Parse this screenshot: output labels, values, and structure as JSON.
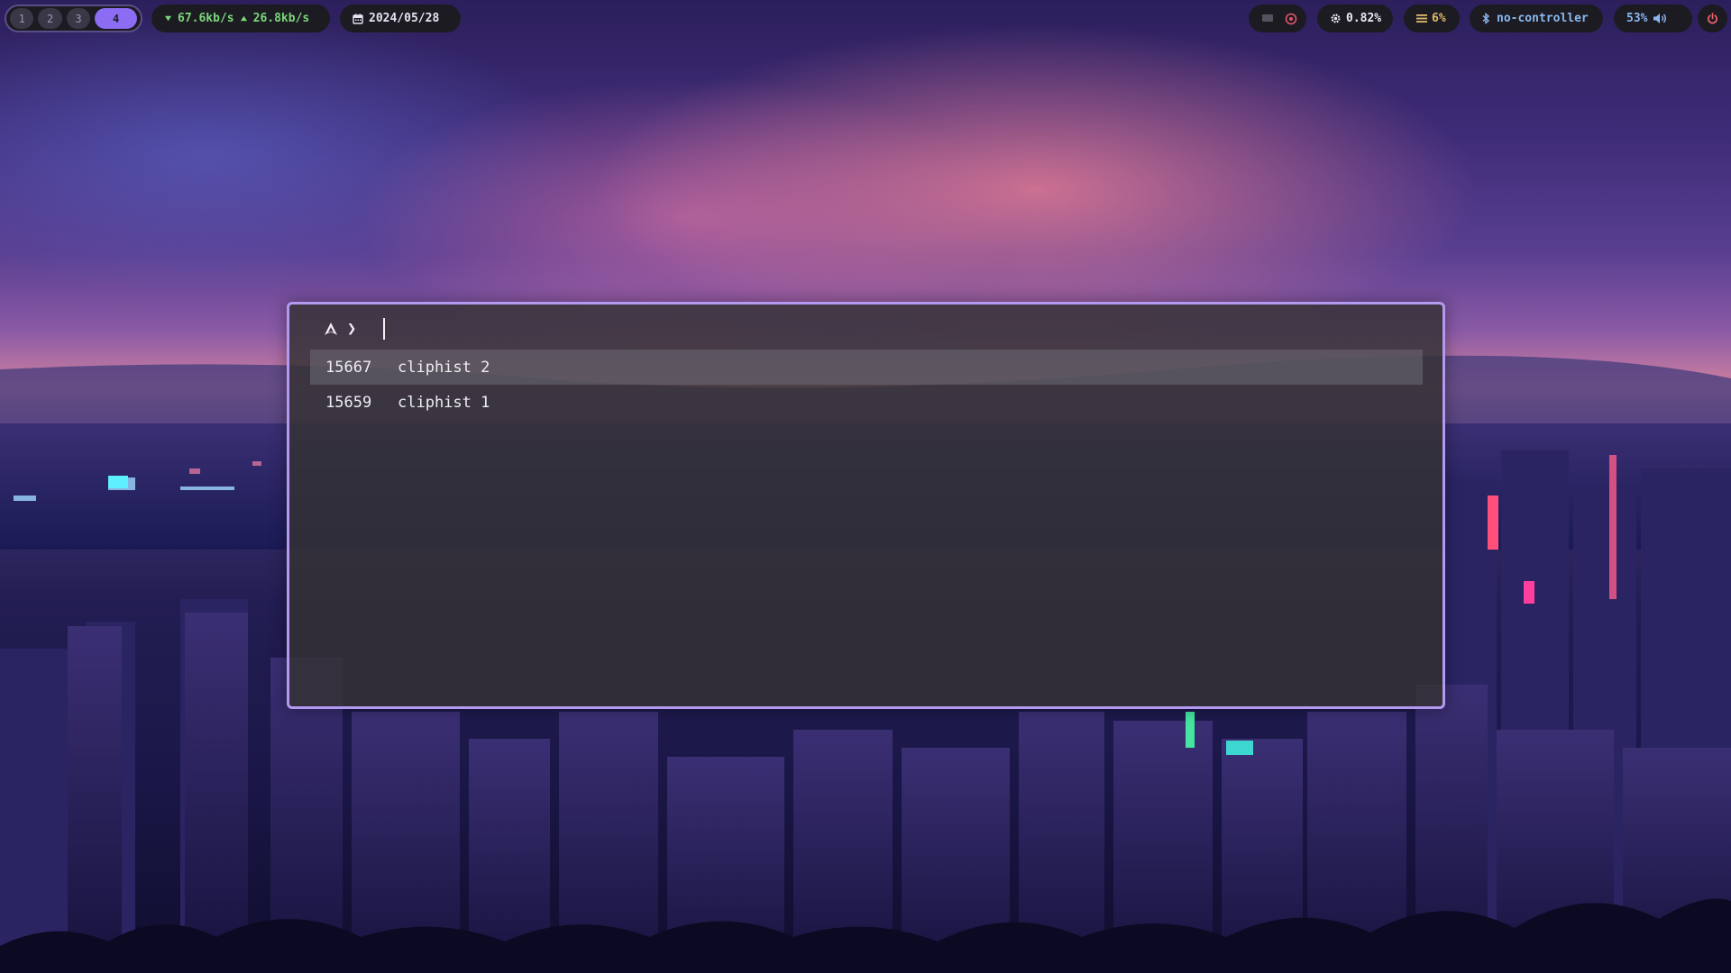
{
  "workspaces": [
    {
      "label": "1",
      "active": false
    },
    {
      "label": "2",
      "active": false
    },
    {
      "label": "3",
      "active": false
    },
    {
      "label": "4",
      "active": true
    }
  ],
  "network": {
    "down": "67.6kb/s",
    "up": "26.8kb/s"
  },
  "date": "2024/05/28",
  "system": {
    "cpu": "0.82%",
    "memory": "6%",
    "bluetooth": "no-controller",
    "volume": "53%"
  },
  "launcher": {
    "prompt_symbol": "❯",
    "query": "",
    "entries": [
      {
        "id": "15667",
        "text": "cliphist 2",
        "selected": true
      },
      {
        "id": "15659",
        "text": "cliphist 1",
        "selected": false
      }
    ]
  },
  "colors": {
    "accent": "#8b6cf2",
    "border": "#b39af0",
    "network": "#7ad77a",
    "memory": "#e0b96a",
    "bluetooth": "#8ab8f0",
    "power": "#f0636a"
  },
  "icons": [
    "arch-logo-icon",
    "download-arrow-icon",
    "upload-arrow-icon",
    "calendar-icon",
    "screen-icon",
    "record-icon",
    "gear-icon",
    "memory-icon",
    "bluetooth-icon",
    "speaker-icon",
    "power-icon"
  ]
}
